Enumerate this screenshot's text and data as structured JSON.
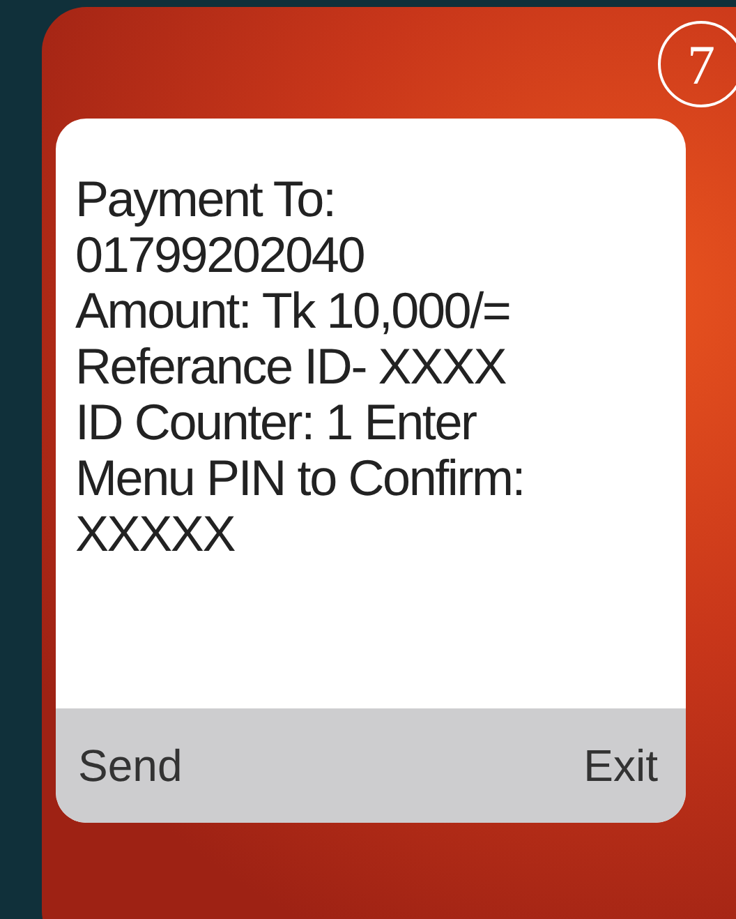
{
  "badge": "7",
  "dialog": {
    "message": "Payment To:\n01799202040\nAmount: Tk 10,000/=\nReferance ID- XXXX\nID Counter: 1 Enter\nMenu PIN to Confirm:\nXXXXX",
    "buttons": [
      {
        "label": "Send"
      },
      {
        "label": "Exit"
      }
    ]
  }
}
